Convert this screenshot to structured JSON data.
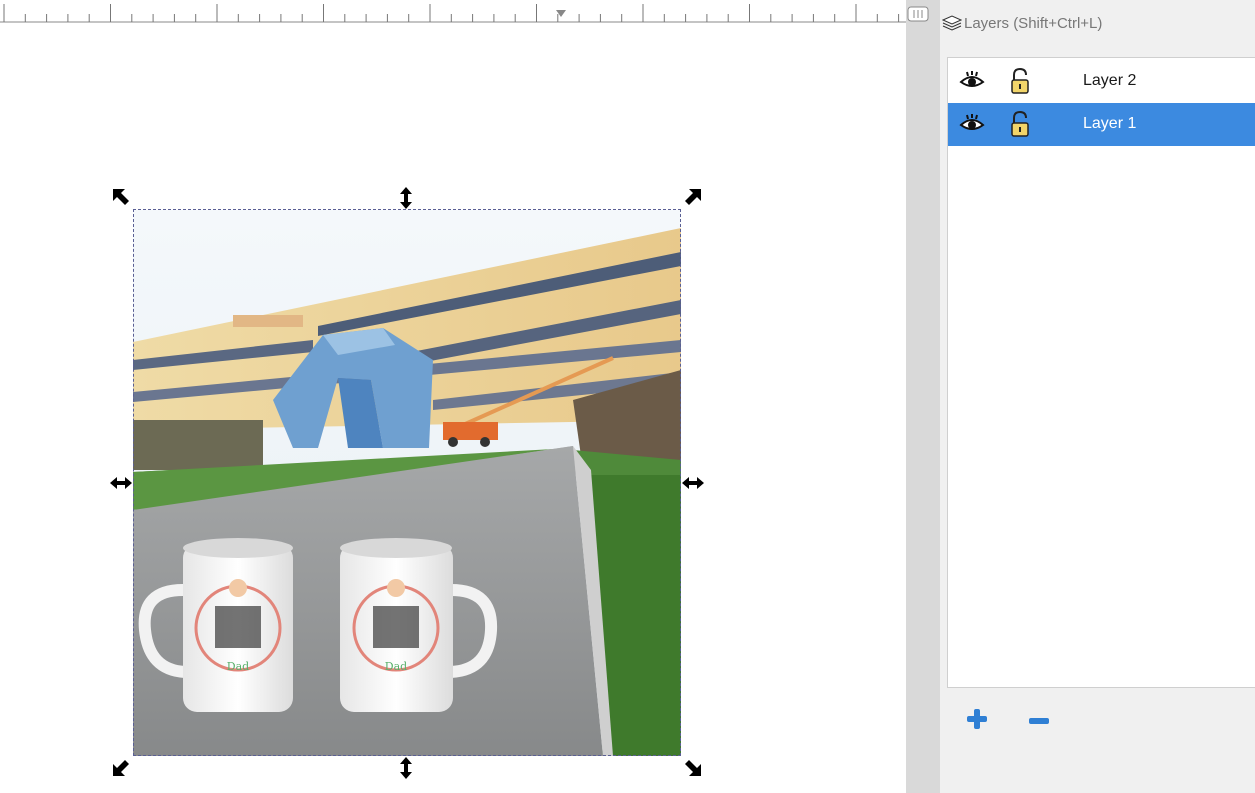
{
  "panel": {
    "title": "Layers (Shift+Ctrl+L)",
    "layers": [
      {
        "name": "Layer 2",
        "visible": true,
        "locked": false,
        "selected": false
      },
      {
        "name": "Layer 1",
        "visible": true,
        "locked": false,
        "selected": true
      }
    ],
    "add_icon": "plus-icon",
    "remove_icon": "minus-icon"
  },
  "canvas": {
    "image": "photo of two white mugs on a granite ledge in front of a blue sculpture and office building",
    "mug_text": "Dad"
  },
  "colors": {
    "selection_highlight": "#3c8ae0",
    "add_icon": "#2f7fd4",
    "remove_icon": "#2f7fd4"
  }
}
